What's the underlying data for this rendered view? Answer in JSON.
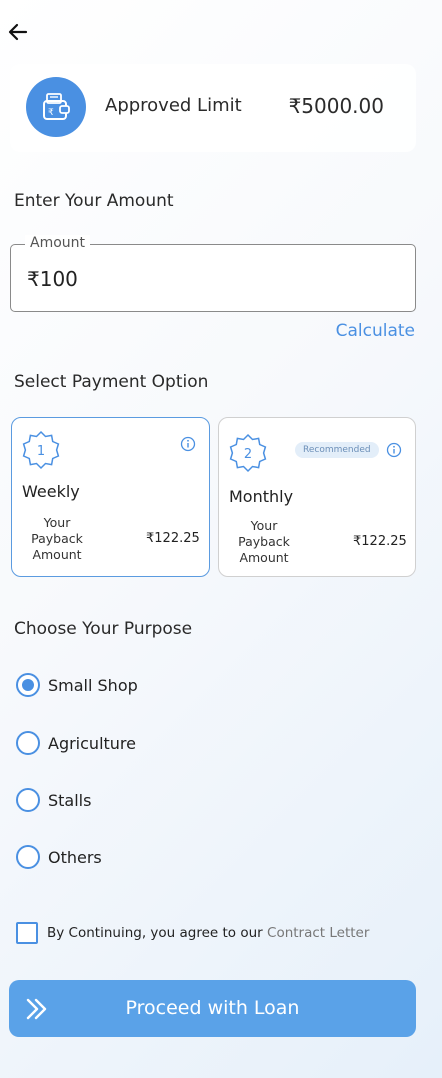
{
  "header": {
    "back_icon": "arrow-left-icon"
  },
  "limit_card": {
    "icon": "wallet-rupee-icon",
    "label": "Approved Limit",
    "value": "₹5000.00",
    "accent_color": "#4a90e2"
  },
  "amount_section": {
    "title": "Enter Your Amount",
    "field_label": "Amount",
    "field_value": "₹100",
    "calculate_label": "Calculate"
  },
  "payment_section": {
    "title": "Select Payment Option",
    "options": [
      {
        "number": "1",
        "name": "Weekly",
        "payback_label": "Your Payback Amount",
        "payback_value": "₹122.25",
        "selected": true,
        "recommended": ""
      },
      {
        "number": "2",
        "name": "Monthly",
        "payback_label": "Your Payback Amount",
        "payback_value": "₹122.25",
        "selected": false,
        "recommended": "Recommended"
      }
    ]
  },
  "purpose_section": {
    "title": "Choose Your Purpose",
    "options": [
      {
        "label": "Small Shop",
        "selected": true
      },
      {
        "label": "Agriculture",
        "selected": false
      },
      {
        "label": "Stalls",
        "selected": false
      },
      {
        "label": "Others",
        "selected": false
      }
    ]
  },
  "terms": {
    "text": "By Continuing, you agree to our",
    "link": "Contract Letter",
    "checked": false
  },
  "proceed": {
    "label": "Proceed with Loan",
    "icon": "double-chevron-right-icon",
    "color": "#5aa2e8"
  }
}
